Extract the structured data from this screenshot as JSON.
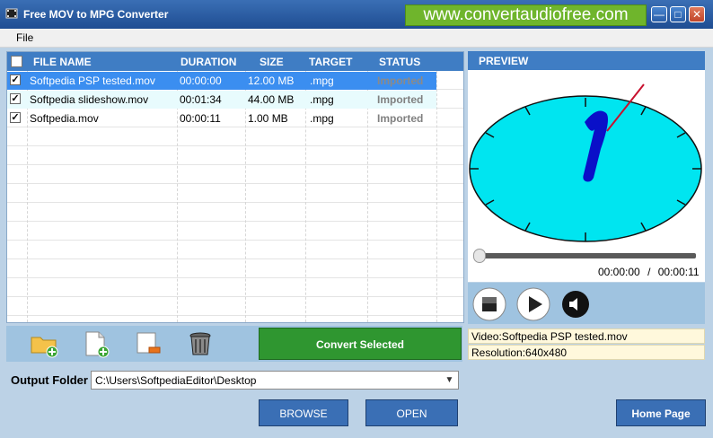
{
  "window": {
    "title": "Free MOV to MPG Converter",
    "banner": "www.convertaudiofree.com"
  },
  "menu": {
    "file": "File"
  },
  "table": {
    "headers": {
      "file_name": "FILE NAME",
      "duration": "DURATION",
      "size": "SIZE",
      "target": "TARGET",
      "status": "STATUS"
    },
    "rows": [
      {
        "file_name": "Softpedia PSP tested.mov",
        "duration": "00:00:00",
        "size": "12.00 MB",
        "target": ".mpg",
        "status": "Imported"
      },
      {
        "file_name": "Softpedia slideshow.mov",
        "duration": "00:01:34",
        "size": "44.00 MB",
        "target": ".mpg",
        "status": "Imported"
      },
      {
        "file_name": "Softpedia.mov",
        "duration": "00:00:11",
        "size": "1.00 MB",
        "target": ".mpg",
        "status": "Imported"
      }
    ]
  },
  "toolbar": {
    "convert_label": "Convert Selected"
  },
  "output": {
    "label": "Output Folder",
    "path": "C:\\Users\\SoftpediaEditor\\Desktop"
  },
  "buttons": {
    "browse": "BROWSE",
    "open": "OPEN",
    "home": "Home Page"
  },
  "preview": {
    "title": "PREVIEW",
    "time_current": "00:00:00",
    "time_separator": "/",
    "time_total": "00:00:11",
    "video_info": "Video:Softpedia PSP tested.mov",
    "resolution_info": "Resolution:640x480",
    "seek_position": 0
  },
  "icons": [
    "add-folder-icon",
    "add-file-icon",
    "remove-file-icon",
    "trash-icon",
    "stop-icon",
    "play-icon",
    "volume-icon"
  ],
  "colors": {
    "header_blue": "#3f7dc4",
    "selected_row": "#3b8ef0",
    "convert_green": "#2f9630",
    "banner_green": "#6fb52c",
    "clock_face": "#00e5f0"
  }
}
